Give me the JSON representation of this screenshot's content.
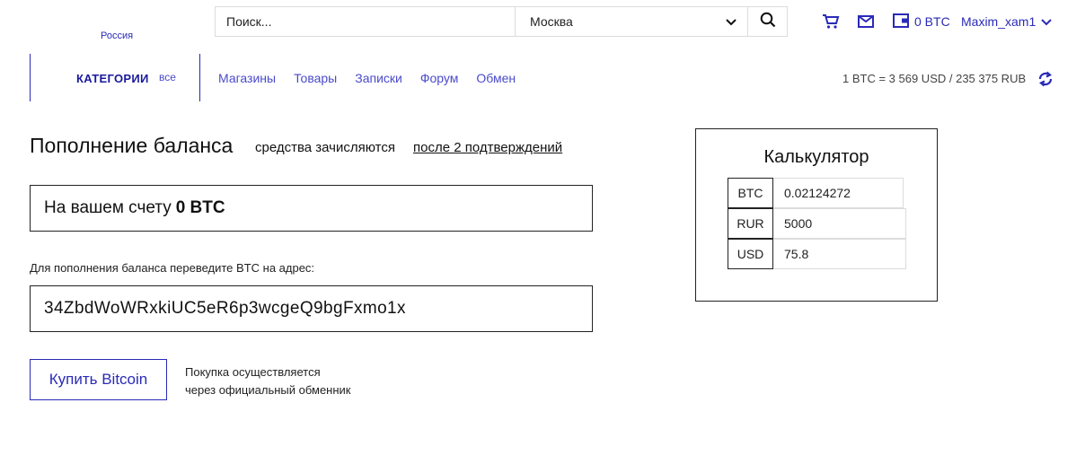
{
  "header": {
    "region": "Россия",
    "search": {
      "placeholder": "Поиск..."
    },
    "city": {
      "selected": "Москва"
    },
    "wallet": {
      "balance": "0 BTC"
    },
    "user": {
      "name": "Maxim_xam1"
    }
  },
  "nav": {
    "categories_label": "КАТЕГОРИИ",
    "categories_all": "все",
    "links": [
      "Магазины",
      "Товары",
      "Записки",
      "Форум",
      "Обмен"
    ],
    "rate": "1 BTC = 3 569 USD / 235 375 RUB"
  },
  "main": {
    "title": "Пополнение баланса",
    "subtitle": "средства зачисляются",
    "subtitle_link": "после 2 подтверждений",
    "balance_prefix": "На вашем счету",
    "balance_value": "0 BTC",
    "address_label": "Для пополнения баланса переведите BTC на адрес:",
    "address": "34ZbdWoWRxkiUC5eR6p3wcgeQ9bgFxmo1x",
    "buy_button": "Купить Bitcoin",
    "buy_note_line1": "Покупка осуществляется",
    "buy_note_line2": "через официальный обменник"
  },
  "calculator": {
    "title": "Калькулятор",
    "rows": [
      {
        "currency": "BTC",
        "value": "0.02124272"
      },
      {
        "currency": "RUR",
        "value": "5000"
      },
      {
        "currency": "USD",
        "value": "75.8"
      }
    ]
  },
  "colors": {
    "accent": "#2a2ab8",
    "text": "#111111",
    "border": "#222222"
  }
}
